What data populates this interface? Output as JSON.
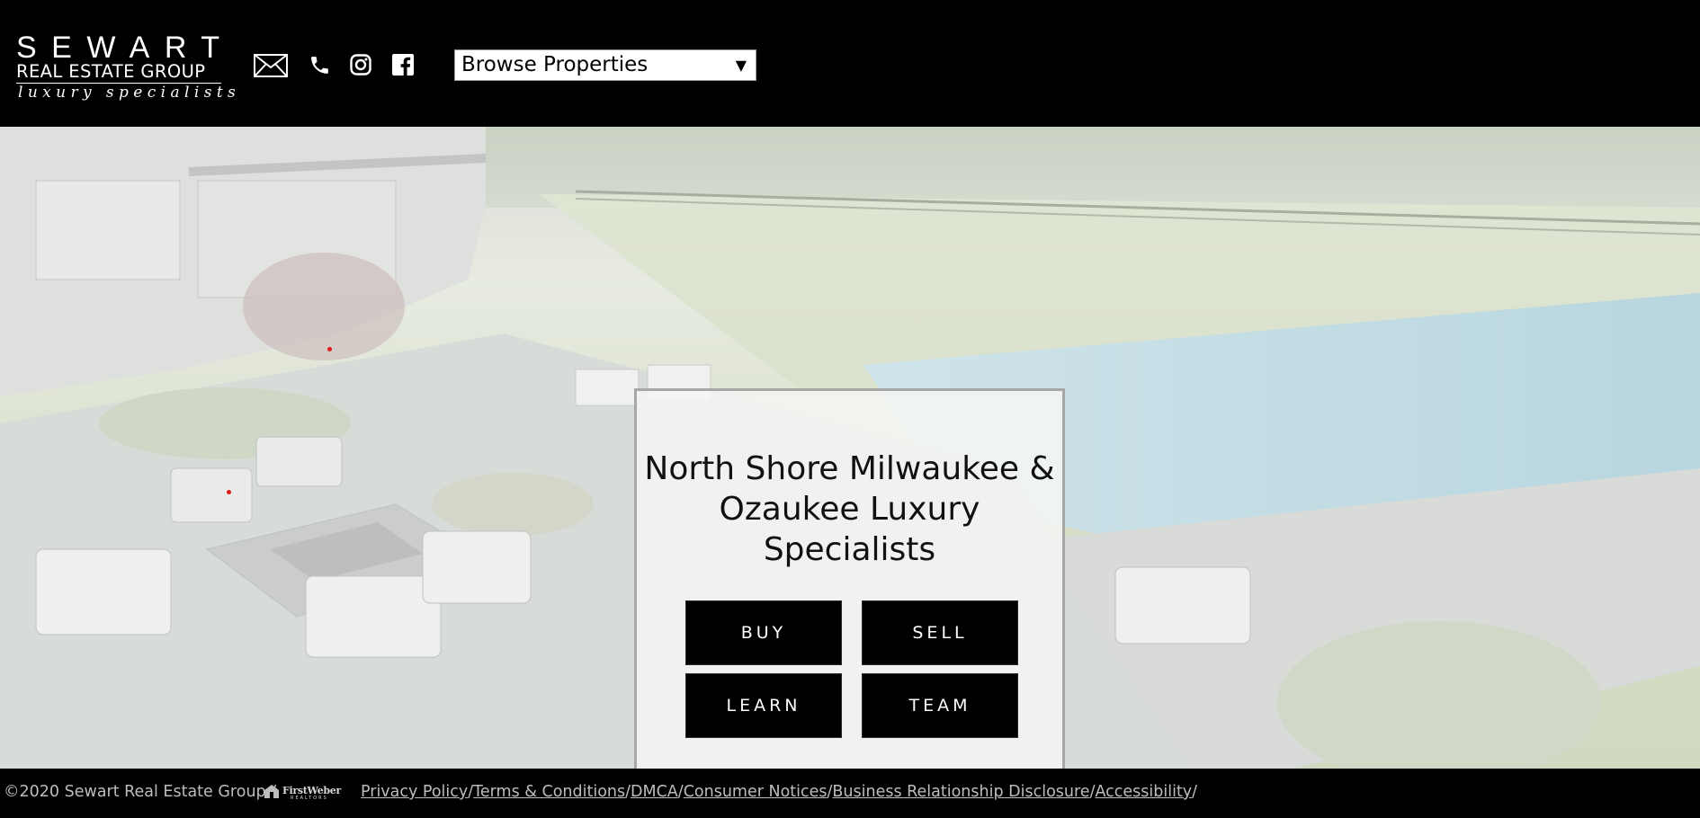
{
  "header": {
    "logo": {
      "line1": "SEWART",
      "line2": "REAL ESTATE GROUP",
      "line3": "luxury specialists"
    },
    "social_icons": [
      "mail-icon",
      "phone-icon",
      "instagram-icon",
      "facebook-icon"
    ],
    "browse_select": {
      "selected": "Browse Properties",
      "arrow": "▼"
    }
  },
  "hero": {
    "title": "North Shore Milwaukee & Ozaukee Luxury Specialists",
    "buttons": {
      "buy": "BUY",
      "sell": "SELL",
      "learn": "LEARN",
      "team": "TEAM"
    }
  },
  "footer": {
    "copyright": "©2020 Sewart Real Estate Group /",
    "brokerage_logo": {
      "name": "FirstWeber",
      "sub": "REALTORS"
    },
    "links": [
      "Privacy Policy",
      "Terms & Conditions",
      "DMCA",
      "Consumer Notices",
      "Business Relationship Disclosure",
      "Accessibility"
    ],
    "separator": "/"
  },
  "colors": {
    "header_bg": "#000000",
    "button_bg": "#000000",
    "button_text": "#ffffff",
    "card_border": "#a7a7a7",
    "footer_text": "#bdbdbd"
  }
}
